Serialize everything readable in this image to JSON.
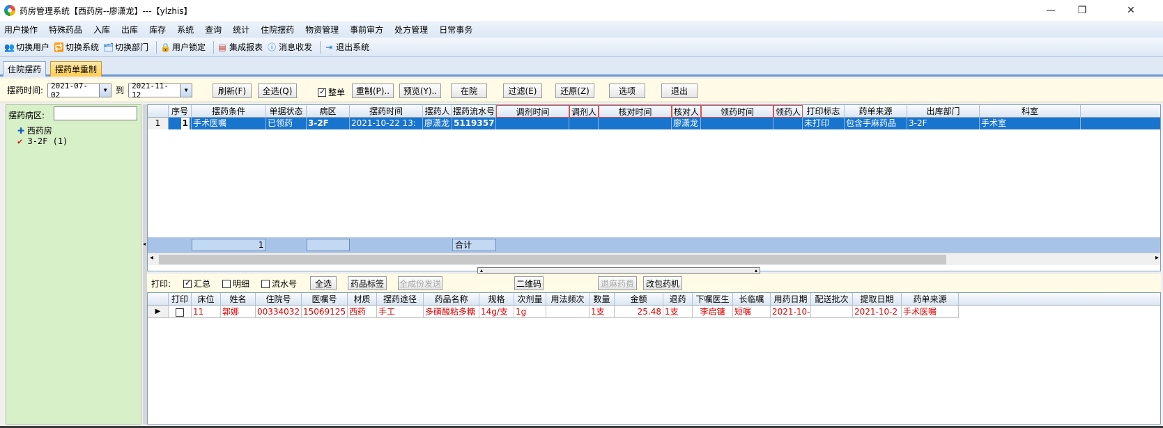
{
  "window": {
    "title": "药房管理系统【西药房--廖潇龙】---【ylzhis】",
    "minimize": "—",
    "restore": "❐",
    "close": "✕"
  },
  "menu": [
    "用户操作",
    "特殊药品",
    "入库",
    "出库",
    "库存",
    "系统",
    "查询",
    "统计",
    "住院摆药",
    "物资管理",
    "事前审方",
    "处方管理",
    "日常事务"
  ],
  "toolbar": [
    {
      "icon": "switch-user-icon",
      "glyph": "👥",
      "label": "切换用户"
    },
    {
      "icon": "switch-system-icon",
      "glyph": "🔁",
      "label": "切换系统"
    },
    {
      "icon": "switch-dept-icon",
      "glyph": "🗂",
      "label": "切换部门"
    },
    {
      "icon": "user-lock-icon",
      "glyph": "🔒",
      "label": "用户锁定"
    },
    {
      "icon": "report-icon",
      "glyph": "▤",
      "label": "集成报表"
    },
    {
      "icon": "message-icon",
      "glyph": "ⓘ",
      "label": "消息收发"
    },
    {
      "icon": "exit-icon",
      "glyph": "⇥",
      "label": "退出系统"
    }
  ],
  "tabs": [
    "住院摆药",
    "摆药单重制"
  ],
  "filter": {
    "time_label": "摆药时间:",
    "from": "2021-07-02",
    "to_label": "到",
    "to": "2021-11-12",
    "whole_label": "整单",
    "buttons": [
      "刷新(F)",
      "全选(Q)",
      "重制(P)..",
      "预览(Y)..",
      "在院",
      "过滤(E)",
      "还原(Z)",
      "选项",
      "退出"
    ]
  },
  "left": {
    "ward_label": "摆药病区:",
    "tree": [
      {
        "label": "西药房"
      },
      {
        "label": "3-2F (1)"
      }
    ]
  },
  "grid1": {
    "columns": [
      "序号",
      "摆药条件",
      "单据状态",
      "病区",
      "摆药时间",
      "摆药人",
      "摆药流水号",
      "调剂时间",
      "调剂人",
      "核对时间",
      "核对人",
      "领药时间",
      "领药人",
      "打印标志",
      "药单来源",
      "出库部门",
      "科室"
    ],
    "row": {
      "rownum": "1",
      "seq": "1",
      "cond": "手术医嘱",
      "state": "已领药",
      "ward": "3-2F",
      "time": "2021-10-22 13:",
      "person": "廖潇龙",
      "serial": "5119357",
      "adj_time": "",
      "adj_person": "",
      "chk_time": "",
      "chk_person": "廖潇龙",
      "get_time": "",
      "get_person": "",
      "print_flag": "未打印",
      "source": "包含手麻药品",
      "out_dept": "3-2F",
      "dept": "手术室"
    },
    "footer": {
      "count": "1",
      "sum_label": "合计"
    }
  },
  "print": {
    "label": "打印:",
    "summary": "汇总",
    "detail": "明细",
    "serial": "流水号",
    "buttons": [
      "全选",
      "药品标签",
      "全成份发送",
      "二维码",
      "退麻药费",
      "改包药机"
    ]
  },
  "grid2": {
    "columns": [
      "打印",
      "床位",
      "姓名",
      "住院号",
      "医嘱号",
      "材质",
      "摆药途径",
      "药品名称",
      "规格",
      "次剂量",
      "用法频次",
      "数量",
      "金额",
      "退药",
      "下嘱医生",
      "长临嘱",
      "用药日期",
      "配送批次",
      "提取日期",
      "药单来源"
    ],
    "row": {
      "bed": "11",
      "name": "郭娜",
      "inpatient": "00334032",
      "order": "15069125",
      "material": "西药",
      "route": "手工",
      "drug": "多磺酸粘多糖",
      "spec": "14g/支",
      "dose": "1g",
      "freq": "",
      "qty": "1支",
      "amount": "25.48",
      "return": "1支",
      "doctor": "李启镛",
      "type": "短嘱",
      "use_date": "2021-10-",
      "batch": "",
      "fetch_date": "2021-10-2",
      "source": "手术医嘱"
    }
  }
}
